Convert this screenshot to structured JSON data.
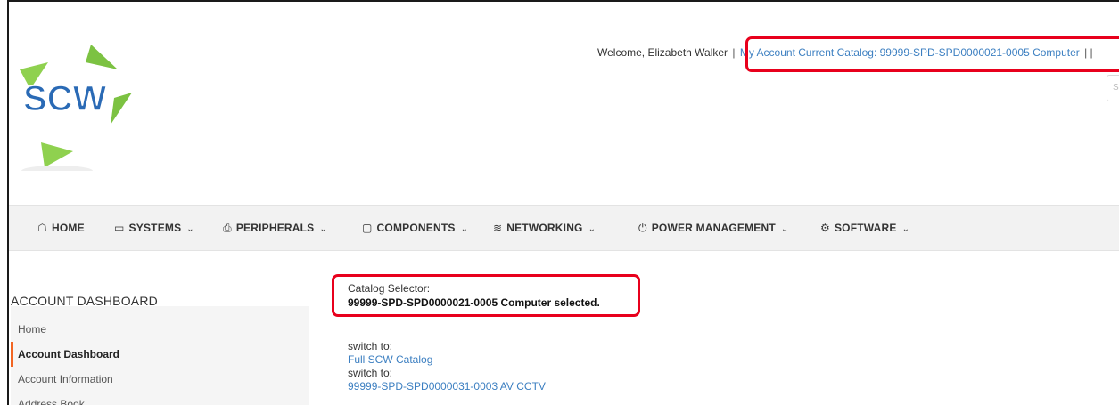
{
  "header": {
    "welcome_text": "Welcome, Elizabeth Walker",
    "separator": "|",
    "my_account_link": "My Account",
    "current_catalog_link": "Current Catalog: 99999-SPD-SPD0000021-0005 Computer",
    "trailing_separators": "| |",
    "logo_text": "SCW",
    "search_placeholder": "Se"
  },
  "nav": {
    "items": [
      {
        "label": "HOME",
        "icon": "home-icon"
      },
      {
        "label": "SYSTEMS",
        "icon": "laptop-icon"
      },
      {
        "label": "PERIPHERALS",
        "icon": "printer-icon"
      },
      {
        "label": "COMPONENTS",
        "icon": "monitor-icon"
      },
      {
        "label": "NETWORKING",
        "icon": "wifi-icon"
      },
      {
        "label": "POWER MANAGEMENT",
        "icon": "power-icon"
      },
      {
        "label": "SOFTWARE",
        "icon": "gears-icon"
      }
    ]
  },
  "sidebar": {
    "title": "ACCOUNT DASHBOARD",
    "items": [
      {
        "label": "Home"
      },
      {
        "label": "Account Dashboard",
        "active": true
      },
      {
        "label": "Account Information"
      },
      {
        "label": "Address Book"
      }
    ]
  },
  "main": {
    "catalog_selector_label": "Catalog Selector:",
    "selected_catalog": "99999-SPD-SPD0000021-0005 Computer selected.",
    "switch_options": [
      {
        "prefix": "switch to:",
        "link": "Full SCW Catalog"
      },
      {
        "prefix": "switch to:",
        "link": "99999-SPD-SPD0000031-0003 AV CCTV"
      }
    ]
  },
  "colors": {
    "highlight": "#e8001c",
    "link": "#3c7fc1",
    "active_accent": "#f26522",
    "logo_green": "#7cc242",
    "logo_blue": "#2a6ab5"
  }
}
